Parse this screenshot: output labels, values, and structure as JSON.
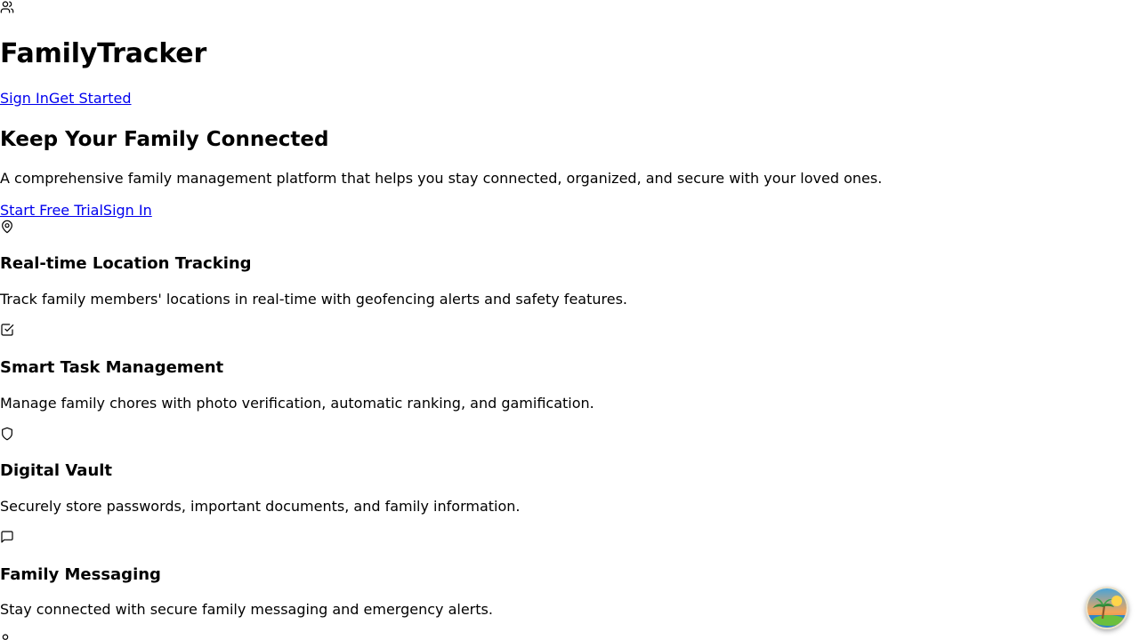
{
  "header": {
    "icon": "users-icon",
    "title": "FamilyTracker",
    "nav": {
      "sign_in": "Sign In",
      "get_started": "Get Started"
    }
  },
  "hero": {
    "title": "Keep Your Family Connected",
    "subtitle": "A comprehensive family management platform that helps you stay connected, organized, and secure with your loved ones.",
    "cta": {
      "start_trial": "Start Free Trial",
      "sign_in": "Sign In"
    }
  },
  "features": [
    {
      "icon": "map-pin-icon",
      "title": "Real-time Location Tracking",
      "description": "Track family members' locations in real-time with geofencing alerts and safety features."
    },
    {
      "icon": "check-square-icon",
      "title": "Smart Task Management",
      "description": "Manage family chores with photo verification, automatic ranking, and gamification."
    },
    {
      "icon": "shield-icon",
      "title": "Digital Vault",
      "description": "Securely store passwords, important documents, and family information."
    },
    {
      "icon": "message-square-icon",
      "title": "Family Messaging",
      "description": "Stay connected with secure family messaging and emergency alerts."
    }
  ],
  "floating_button": {
    "icon": "island-avatar-icon"
  }
}
